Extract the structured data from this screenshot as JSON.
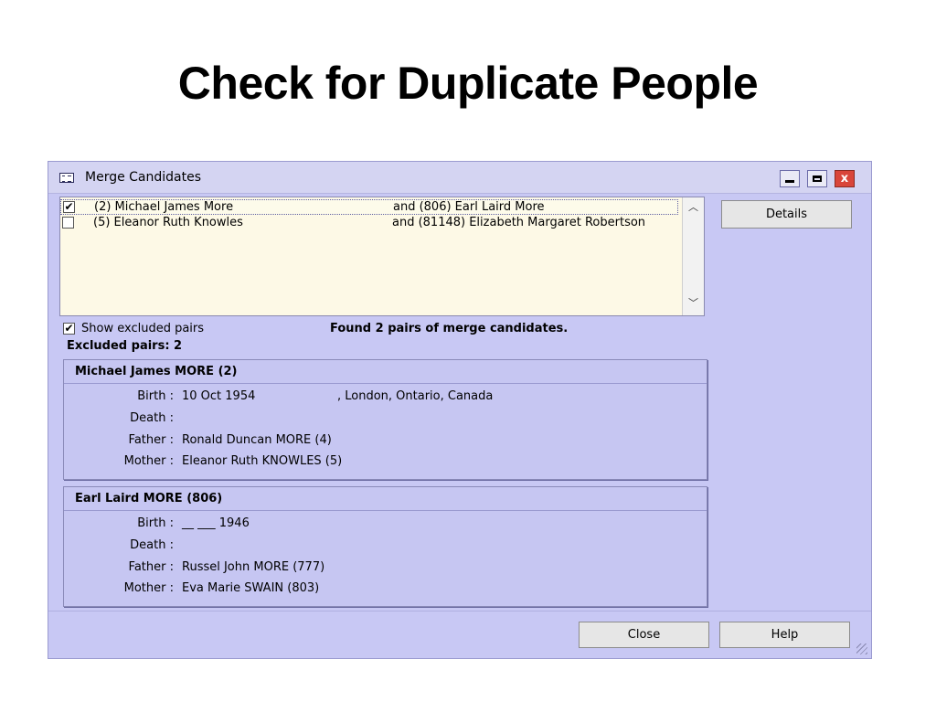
{
  "slide": {
    "title": "Check for Duplicate People"
  },
  "window": {
    "title": "Merge Candidates",
    "close_glyph": "x"
  },
  "candidates": [
    {
      "checked": true,
      "person_a": "(2) Michael James More",
      "person_b": "and (806) Earl Laird More"
    },
    {
      "checked": false,
      "person_a": "(5) Eleanor Ruth Knowles",
      "person_b": "and (81148) Elizabeth Margaret Robertson"
    }
  ],
  "details_label": "Details",
  "show_excluded": {
    "checked": true,
    "label": "Show excluded pairs"
  },
  "found_message": "Found 2 pairs of merge candidates.",
  "excluded_count": "Excluded pairs: 2",
  "persons": [
    {
      "header": "Michael James MORE (2)",
      "facts": [
        {
          "label": "Birth :",
          "value": "10 Oct 1954",
          "place": ", London, Ontario, Canada"
        },
        {
          "label": "Death :",
          "value": "",
          "place": ""
        },
        {
          "label": "Father :",
          "value": "Ronald Duncan MORE (4)",
          "place": ""
        },
        {
          "label": "Mother :",
          "value": "Eleanor Ruth KNOWLES (5)",
          "place": ""
        }
      ]
    },
    {
      "header": "Earl Laird MORE (806)",
      "facts": [
        {
          "label": "Birth :",
          "value": "__ ___ 1946",
          "place": ""
        },
        {
          "label": "Death :",
          "value": "",
          "place": ""
        },
        {
          "label": "Father :",
          "value": "Russel John MORE (777)",
          "place": ""
        },
        {
          "label": "Mother :",
          "value": "Eva Marie SWAIN (803)",
          "place": ""
        }
      ]
    }
  ],
  "buttons": {
    "close": "Close",
    "help": "Help"
  },
  "icons": {
    "window_icon": "list-window-icon",
    "minimize": "minimize-icon",
    "maximize": "maximize-icon",
    "close": "close-icon",
    "check": "✔",
    "scroll_up": "︿",
    "scroll_down": "﹀"
  },
  "colors": {
    "window_bg": "#c8c8f4",
    "list_bg": "#fdf9e6",
    "close_button": "#d9453a"
  }
}
